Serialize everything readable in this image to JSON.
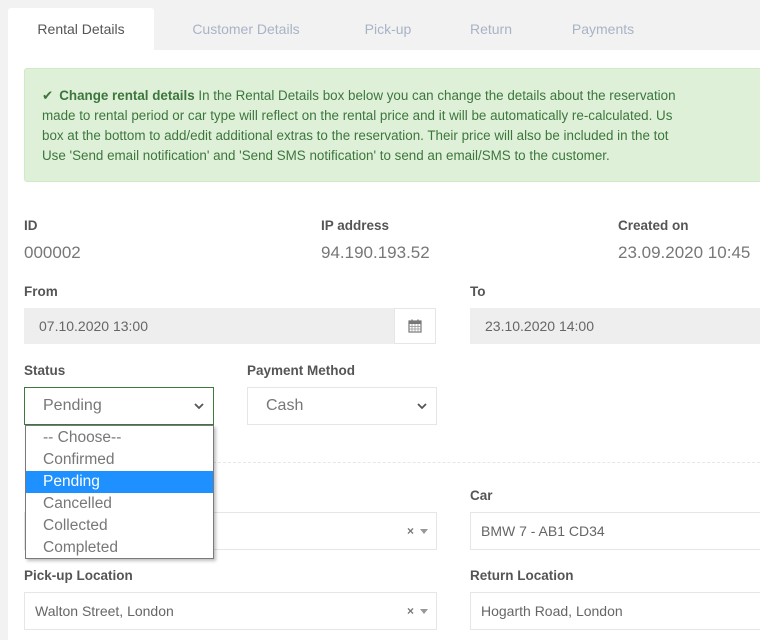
{
  "tabs": [
    {
      "label": "Rental Details",
      "active": true
    },
    {
      "label": "Customer Details",
      "active": false
    },
    {
      "label": "Pick-up",
      "active": false
    },
    {
      "label": "Return",
      "active": false
    },
    {
      "label": "Payments",
      "active": false
    }
  ],
  "alert": {
    "icon": "check-icon",
    "title": "Change rental details",
    "lines": [
      " In the Rental Details box below you can change the details about the reservation",
      "made to rental period or car type will reflect on the rental price and it will be automatically re-calculated. Us",
      "box at the bottom to add/edit additional extras to the reservation. Their price will also be included in the tot",
      "Use 'Send email notification' and 'Send SMS notification' to send an email/SMS to the customer."
    ],
    "bg_color": "#dff0d8",
    "text_color": "#3c763d"
  },
  "info": {
    "id": {
      "label": "ID",
      "value": "000002"
    },
    "ip": {
      "label": "IP address",
      "value": "94.190.193.52"
    },
    "created": {
      "label": "Created on",
      "value": "23.09.2020 10:45"
    }
  },
  "form": {
    "from": {
      "label": "From",
      "value": "07.10.2020 13:00",
      "icon": "calendar-icon"
    },
    "to": {
      "label": "To",
      "value": "23.10.2020 14:00"
    },
    "status": {
      "label": "Status",
      "value": "Pending",
      "options": [
        "-- Choose--",
        "Confirmed",
        "Pending",
        "Cancelled",
        "Collected",
        "Completed"
      ],
      "selected_index": 2,
      "highlight_color": "#1e90ff"
    },
    "payment_method": {
      "label": "Payment Method",
      "value": "Cash"
    },
    "car": {
      "label": "Car",
      "value": "BMW 7 - AB1 CD34"
    },
    "pickup_location": {
      "label": "Pick-up Location",
      "value": "Walton Street, London",
      "clear": "×"
    },
    "return_location": {
      "label": "Return Location",
      "value": "Hogarth Road, London"
    },
    "hidden_select": {
      "clear": "×"
    }
  }
}
